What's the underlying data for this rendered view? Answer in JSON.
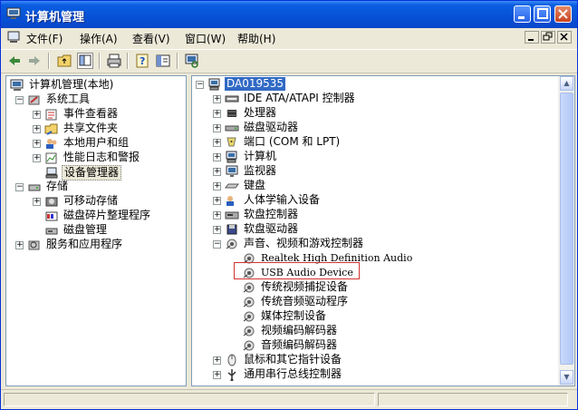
{
  "window": {
    "title": "计算机管理"
  },
  "menu": [
    {
      "label": "文件(F)"
    },
    {
      "label": "操作(A)"
    },
    {
      "label": "查看(V)"
    },
    {
      "label": "窗口(W)"
    },
    {
      "label": "帮助(H)"
    }
  ],
  "left_tree": [
    {
      "label": "计算机管理(本地)",
      "icon": "computer-management-icon",
      "level": 0,
      "expander": ""
    },
    {
      "label": "系统工具",
      "icon": "system-tools-icon",
      "level": 1,
      "expander": "−"
    },
    {
      "label": "事件查看器",
      "icon": "event-viewer-icon",
      "level": 2,
      "expander": "+"
    },
    {
      "label": "共享文件夹",
      "icon": "shared-folders-icon",
      "level": 2,
      "expander": "+"
    },
    {
      "label": "本地用户和组",
      "icon": "local-users-icon",
      "level": 2,
      "expander": "+"
    },
    {
      "label": "性能日志和警报",
      "icon": "performance-logs-icon",
      "level": 2,
      "expander": "+"
    },
    {
      "label": "设备管理器",
      "icon": "device-manager-icon",
      "level": 2,
      "expander": "",
      "selected_box": true
    },
    {
      "label": "存储",
      "icon": "storage-icon",
      "level": 1,
      "expander": "−"
    },
    {
      "label": "可移动存储",
      "icon": "removable-storage-icon",
      "level": 2,
      "expander": "+"
    },
    {
      "label": "磁盘碎片整理程序",
      "icon": "defrag-icon",
      "level": 2,
      "expander": ""
    },
    {
      "label": "磁盘管理",
      "icon": "disk-management-icon",
      "level": 2,
      "expander": ""
    },
    {
      "label": "服务和应用程序",
      "icon": "services-icon",
      "level": 1,
      "expander": "+"
    }
  ],
  "right_tree": [
    {
      "label": "DA019535",
      "icon": "computer-icon",
      "level": 0,
      "expander": "−",
      "selected": true
    },
    {
      "label": "IDE ATA/ATAPI 控制器",
      "icon": "ide-controller-icon",
      "level": 1,
      "expander": "+"
    },
    {
      "label": "处理器",
      "icon": "processor-icon",
      "level": 1,
      "expander": "+"
    },
    {
      "label": "磁盘驱动器",
      "icon": "disk-drive-icon",
      "level": 1,
      "expander": "+"
    },
    {
      "label": "端口 (COM 和 LPT)",
      "icon": "port-icon",
      "level": 1,
      "expander": "+"
    },
    {
      "label": "计算机",
      "icon": "computer-icon",
      "level": 1,
      "expander": "+"
    },
    {
      "label": "监视器",
      "icon": "monitor-icon",
      "level": 1,
      "expander": "+"
    },
    {
      "label": "键盘",
      "icon": "keyboard-icon",
      "level": 1,
      "expander": "+"
    },
    {
      "label": "人体学输入设备",
      "icon": "hid-icon",
      "level": 1,
      "expander": "+"
    },
    {
      "label": "软盘控制器",
      "icon": "floppy-controller-icon",
      "level": 1,
      "expander": "+"
    },
    {
      "label": "软盘驱动器",
      "icon": "floppy-drive-icon",
      "level": 1,
      "expander": "+"
    },
    {
      "label": "声音、视频和游戏控制器",
      "icon": "sound-icon",
      "level": 1,
      "expander": "−"
    },
    {
      "label": "Realtek High Definition Audio",
      "icon": "sound-icon",
      "level": 2,
      "expander": "",
      "mono": true
    },
    {
      "label": "USB Audio Device",
      "icon": "sound-icon",
      "level": 2,
      "expander": "",
      "mono": true,
      "highlighted": true
    },
    {
      "label": "传统视频捕捉设备",
      "icon": "sound-icon",
      "level": 2,
      "expander": ""
    },
    {
      "label": "传统音频驱动程序",
      "icon": "sound-icon",
      "level": 2,
      "expander": ""
    },
    {
      "label": "媒体控制设备",
      "icon": "sound-icon",
      "level": 2,
      "expander": ""
    },
    {
      "label": "视频编码解码器",
      "icon": "sound-icon",
      "level": 2,
      "expander": ""
    },
    {
      "label": "音频编码解码器",
      "icon": "sound-icon",
      "level": 2,
      "expander": ""
    },
    {
      "label": "鼠标和其它指针设备",
      "icon": "mouse-icon",
      "level": 1,
      "expander": "+"
    },
    {
      "label": "通用串行总线控制器",
      "icon": "usb-icon",
      "level": 1,
      "expander": "+"
    }
  ],
  "colors": {
    "title_bar": "#0651d6",
    "selection": "#316ac5",
    "highlight_box": "#d43232"
  }
}
